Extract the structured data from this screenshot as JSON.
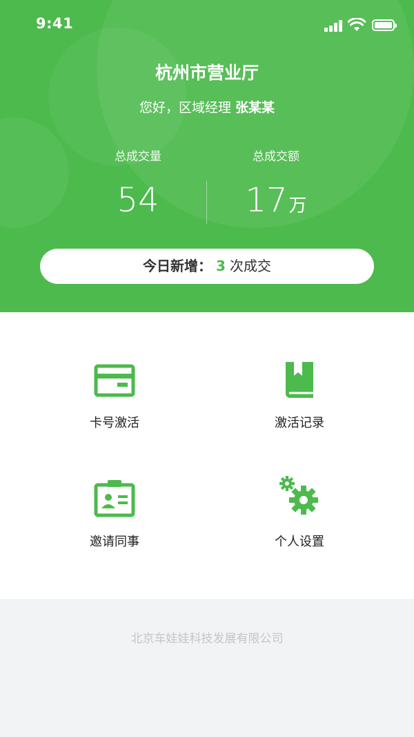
{
  "status_bar": {
    "time": "9:41"
  },
  "header": {
    "office_name": "杭州市营业厅",
    "greeting_prefix": "您好，区域经理",
    "manager_name": "张某某"
  },
  "stats": {
    "volume_label": "总成交量",
    "volume_value": "54",
    "amount_label": "总成交额",
    "amount_value": "17",
    "amount_unit": "万"
  },
  "today": {
    "label": "今日新增：",
    "count": "3",
    "suffix": "次成交"
  },
  "menu": {
    "items": [
      {
        "label": "卡号激活",
        "icon": "card-icon"
      },
      {
        "label": "激活记录",
        "icon": "book-icon"
      },
      {
        "label": "邀请同事",
        "icon": "badge-icon"
      },
      {
        "label": "个人设置",
        "icon": "gear-icon"
      }
    ]
  },
  "footer": {
    "company": "北京车娃娃科技发展有限公司"
  },
  "colors": {
    "brand": "#4cba4c",
    "background": "#f2f3f5"
  }
}
